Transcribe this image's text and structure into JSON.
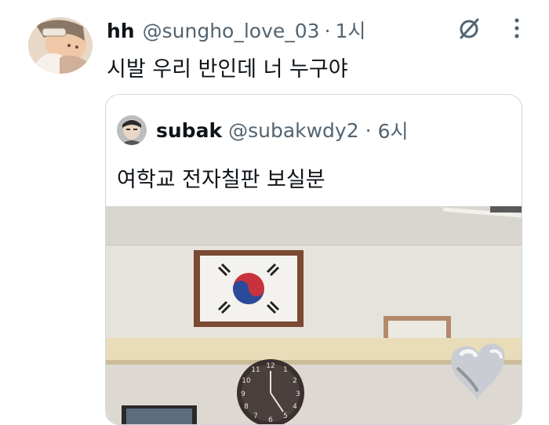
{
  "tweet": {
    "display_name": "hh",
    "handle": "@sungho_love_03",
    "separator": "·",
    "time": "1시",
    "text": "시발 우리 반인데 너 누구야"
  },
  "quoted": {
    "display_name": "subak",
    "handle": "@subakwdy2",
    "separator": "·",
    "time": "6시",
    "text": "여학교 전자칠판 보실분"
  },
  "icons": {
    "grok": "grok-icon",
    "more": "more-icon"
  },
  "colors": {
    "text": "#0f1419",
    "secondary": "#536471",
    "border": "#cfd9de"
  }
}
